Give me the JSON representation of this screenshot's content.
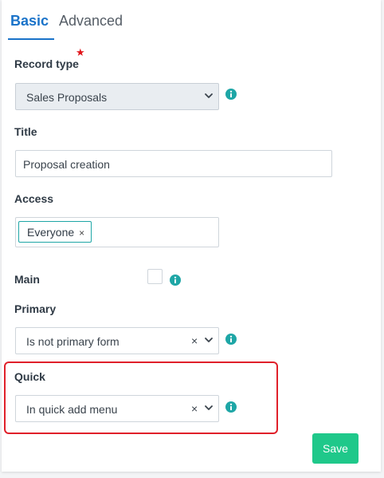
{
  "tabs": {
    "basic": "Basic",
    "advanced": "Advanced"
  },
  "fields": {
    "record_type": {
      "label": "Record type",
      "required_mark": "★",
      "value": "Sales Proposals"
    },
    "title": {
      "label": "Title",
      "value": "Proposal creation"
    },
    "access": {
      "label": "Access",
      "tag": "Everyone",
      "tag_remove": "×"
    },
    "main": {
      "label": "Main",
      "checked": false
    },
    "primary": {
      "label": "Primary",
      "value": "Is not primary form",
      "clear": "×"
    },
    "quick": {
      "label": "Quick",
      "value": "In quick add menu",
      "clear": "×"
    }
  },
  "actions": {
    "save": "Save"
  },
  "colors": {
    "accent": "#1a73c9",
    "save": "#1fc88a",
    "info": "#1ea6a6",
    "highlight": "#e0202a"
  },
  "icons": {
    "info": "info-icon",
    "chevron": "chevron-down-icon",
    "clear": "clear-icon"
  }
}
